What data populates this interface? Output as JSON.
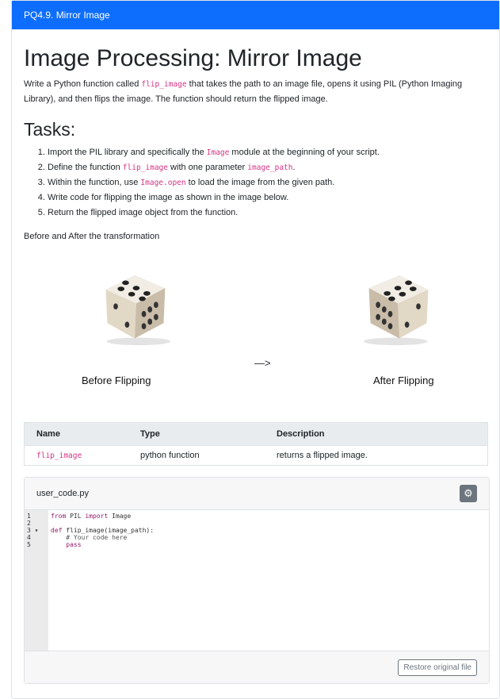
{
  "header": {
    "title": "PQ4.9. Mirror Image"
  },
  "main": {
    "title": "Image Processing: Mirror Image",
    "intro_1": "Write a Python function called ",
    "intro_code": "flip_image",
    "intro_2": " that takes the path to an image file, opens it using PIL (Python Imaging Library), and then flips the image. The function should return the flipped image.",
    "tasks_heading": "Tasks:",
    "tasks": [
      {
        "a": "Import the PIL library and specifically the ",
        "code": "Image",
        "b": " module at the beginning of your script."
      },
      {
        "a": "Define the function ",
        "code": "flip_image",
        "b": " with one parameter ",
        "code2": "image_path",
        "c": "."
      },
      {
        "a": "Within the function, use ",
        "code": "Image.open",
        "b": " to load the image from the given path."
      },
      {
        "a": "Write code for flipping the image as shown in the image below.",
        "code": "",
        "b": ""
      },
      {
        "a": "Return the flipped image object from the function.",
        "code": "",
        "b": ""
      }
    ],
    "before_after": "Before and After the transformation",
    "figure": {
      "before_caption": "Before Flipping",
      "arrow": "—>",
      "after_caption": "After Flipping"
    }
  },
  "table": {
    "headers": [
      "Name",
      "Type",
      "Description"
    ],
    "rows": [
      [
        "flip_image",
        "python function",
        "returns a flipped image."
      ]
    ]
  },
  "editor": {
    "filename": "user_code.py",
    "gear_icon": "gear-icon",
    "lines": [
      "1",
      "2",
      "3",
      "4",
      "5"
    ],
    "restore_label": "Restore original file"
  }
}
